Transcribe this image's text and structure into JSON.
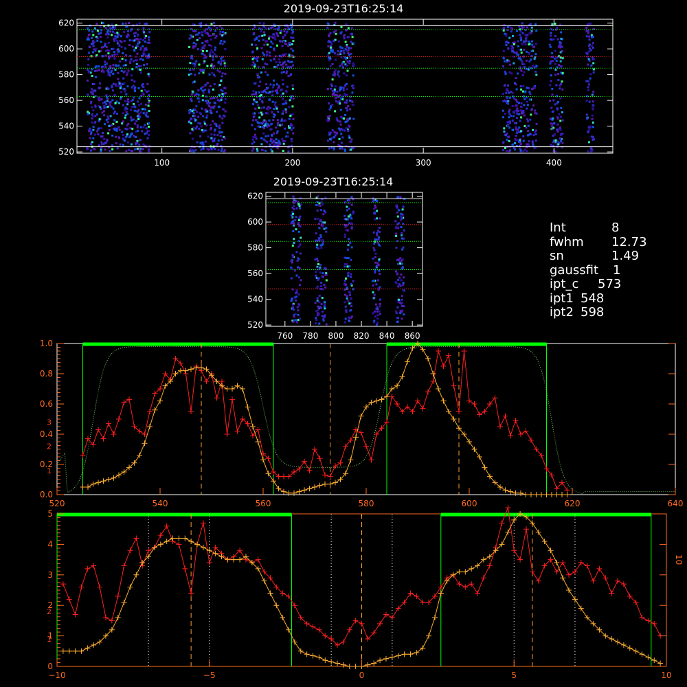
{
  "stats": {
    "int_label": "Int",
    "int_value": "8",
    "fwhm_label": "fwhm",
    "fwhm_value": "12.73",
    "sn_label": "sn",
    "sn_value": "1.49",
    "gaussfit_label": "gaussfit",
    "gaussfit_value": "1",
    "iptc_label": "ipt_c",
    "iptc_value": "573",
    "ipt1_label": "ipt1",
    "ipt1_value": "548",
    "ipt2_label": "ipt2",
    "ipt2_value": "598"
  },
  "colors": {
    "background": "#000000",
    "axes": "#ffffff",
    "red_profile": "#ff2020",
    "orange_profile": "#ffb030",
    "green_window": "#00ff00",
    "orange_axis": "#ff6a20",
    "white_axis": "#ffffff"
  },
  "chart_data": [
    {
      "type": "heatmap",
      "title": "2019-09-23T16:25:14",
      "xlim": [
        35,
        445
      ],
      "ylim": [
        519,
        623
      ],
      "xticks": [
        "100",
        "200",
        "300",
        "400"
      ],
      "yticks": [
        "520",
        "540",
        "560",
        "580",
        "600",
        "620"
      ],
      "bright_columns": [
        [
          42,
          90
        ],
        [
          120,
          148
        ],
        [
          168,
          200
        ],
        [
          226,
          246
        ],
        [
          360,
          386
        ],
        [
          396,
          406
        ],
        [
          424,
          430
        ]
      ],
      "guide_lines": [
        {
          "y": 524,
          "color": "#ffffff"
        },
        {
          "y": 618,
          "color": "#ffffff"
        },
        {
          "y": 615,
          "color": "#00ff00"
        },
        {
          "y": 594,
          "color": "#ff2020"
        },
        {
          "y": 585,
          "color": "#00ff00"
        },
        {
          "y": 563,
          "color": "#00ff00"
        }
      ]
    },
    {
      "type": "heatmap",
      "title": "2019-09-23T16:25:14",
      "xlim": [
        745,
        868
      ],
      "ylim": [
        519,
        623
      ],
      "xticks": [
        "760",
        "780",
        "800",
        "820",
        "840",
        "860"
      ],
      "yticks": [
        "520",
        "540",
        "560",
        "580",
        "600",
        "620"
      ],
      "bright_columns": [
        [
          764,
          772
        ],
        [
          783,
          792
        ],
        [
          806,
          813
        ],
        [
          828,
          834
        ],
        [
          846,
          853
        ]
      ],
      "guide_lines": [
        {
          "y": 618,
          "color": "#ffffff"
        },
        {
          "y": 615,
          "color": "#00ff00"
        },
        {
          "y": 585,
          "color": "#00ff00"
        },
        {
          "y": 563,
          "color": "#00ff00"
        },
        {
          "y": 548,
          "color": "#ff2020"
        },
        {
          "y": 598,
          "color": "#ff2020"
        }
      ]
    },
    {
      "type": "line",
      "xlim": [
        520,
        640
      ],
      "xticks": [
        "520",
        "540",
        "560",
        "580",
        "600",
        "620",
        "640"
      ],
      "ylim": [
        0,
        1.0
      ],
      "yticks": [
        "0.0",
        "0.2",
        "0.4",
        "0.6",
        "0.8",
        "1.0"
      ],
      "right_red_ticks": [
        "1",
        "2",
        "3"
      ],
      "series": [
        {
          "color": "#ff2020",
          "x": [
            525,
            526,
            527,
            528,
            529,
            530,
            531,
            532,
            533,
            534,
            535,
            536,
            537,
            538,
            539,
            540,
            541,
            542,
            543,
            544,
            545,
            546,
            547,
            548,
            549,
            550,
            551,
            552,
            553,
            554,
            555,
            556,
            557,
            558,
            559,
            560,
            561,
            562,
            563,
            564,
            565,
            566,
            567,
            568,
            569,
            570,
            571,
            572,
            573,
            574,
            575,
            576,
            577,
            578,
            579,
            580,
            581,
            582,
            583,
            584,
            585,
            586,
            587,
            588,
            589,
            590,
            591,
            592,
            593,
            594,
            595,
            596,
            597,
            598,
            599,
            600,
            601,
            602,
            603,
            604,
            605,
            606,
            607,
            608,
            609,
            610,
            611,
            612,
            613,
            614,
            615,
            616,
            617,
            618,
            619
          ],
          "y": [
            0.26,
            0.37,
            0.33,
            0.43,
            0.37,
            0.47,
            0.4,
            0.5,
            0.61,
            0.63,
            0.45,
            0.42,
            0.4,
            0.55,
            0.67,
            0.7,
            0.8,
            0.76,
            0.9,
            0.87,
            0.8,
            0.55,
            0.85,
            0.82,
            0.75,
            0.8,
            0.64,
            0.75,
            0.4,
            0.63,
            0.42,
            0.5,
            0.47,
            0.39,
            0.43,
            0.27,
            0.24,
            0.15,
            0.12,
            0.12,
            0.12,
            0.15,
            0.17,
            0.22,
            0.16,
            0.3,
            0.24,
            0.13,
            0.12,
            0.19,
            0.21,
            0.32,
            0.36,
            0.43,
            0.41,
            0.32,
            0.23,
            0.4,
            0.44,
            0.48,
            0.65,
            0.6,
            0.55,
            0.58,
            0.55,
            0.62,
            0.57,
            0.68,
            0.75,
            0.95,
            0.85,
            0.92,
            0.72,
            0.55,
            0.95,
            0.62,
            0.6,
            0.53,
            0.55,
            0.6,
            0.64,
            0.45,
            0.52,
            0.39,
            0.49,
            0.4,
            0.42,
            0.36,
            0.3,
            0.26,
            0.17,
            0.13,
            0.04,
            0.08,
            0.03
          ]
        },
        {
          "color": "#ffb030",
          "x": [
            525,
            526,
            527,
            528,
            529,
            530,
            531,
            532,
            533,
            534,
            535,
            536,
            537,
            538,
            539,
            540,
            541,
            542,
            543,
            544,
            545,
            546,
            547,
            548,
            549,
            550,
            551,
            552,
            553,
            554,
            555,
            556,
            557,
            558,
            559,
            560,
            561,
            562,
            563,
            564,
            565,
            566,
            567,
            568,
            569,
            570,
            571,
            572,
            573,
            574,
            575,
            576,
            577,
            578,
            579,
            580,
            581,
            582,
            583,
            584,
            585,
            586,
            587,
            588,
            589,
            590,
            591,
            592,
            593,
            594,
            595,
            596,
            597,
            598,
            599,
            600,
            601,
            602,
            603,
            604,
            605,
            606,
            607,
            608,
            609,
            610,
            611,
            612,
            613,
            614,
            615,
            616,
            617,
            618,
            619
          ],
          "y": [
            0.05,
            0.05,
            0.07,
            0.08,
            0.09,
            0.1,
            0.11,
            0.13,
            0.15,
            0.18,
            0.21,
            0.26,
            0.34,
            0.45,
            0.56,
            0.62,
            0.72,
            0.75,
            0.8,
            0.82,
            0.82,
            0.83,
            0.84,
            0.84,
            0.83,
            0.79,
            0.75,
            0.72,
            0.7,
            0.7,
            0.72,
            0.7,
            0.58,
            0.45,
            0.35,
            0.23,
            0.14,
            0.09,
            0.04,
            0.02,
            0.01,
            0.01,
            0.02,
            0.03,
            0.04,
            0.05,
            0.06,
            0.07,
            0.07,
            0.08,
            0.1,
            0.14,
            0.23,
            0.38,
            0.52,
            0.58,
            0.61,
            0.62,
            0.63,
            0.65,
            0.7,
            0.72,
            0.78,
            0.88,
            0.97,
            1.0,
            0.96,
            0.9,
            0.8,
            0.7,
            0.62,
            0.55,
            0.5,
            0.44,
            0.4,
            0.35,
            0.3,
            0.25,
            0.18,
            0.12,
            0.08,
            0.05,
            0.03,
            0.02,
            0.01,
            0.01,
            0.0,
            0.0,
            0.0,
            0.0,
            0.0,
            0.0,
            0.0,
            0.0,
            0.0
          ]
        }
      ],
      "green_windows": [
        [
          525,
          562
        ],
        [
          584,
          615
        ]
      ],
      "vertical_markers": [
        548,
        573,
        598
      ]
    },
    {
      "type": "line",
      "xlim": [
        -10,
        10
      ],
      "xticks": [
        "−10",
        "−5",
        "0",
        "5",
        "10"
      ],
      "ylim": [
        0,
        5
      ],
      "yticks": [
        "0",
        "1",
        "2",
        "3",
        "4",
        "5"
      ],
      "right_red_ticks": [
        "1",
        "2"
      ],
      "right_orange_ticks": [
        "10"
      ],
      "series": [
        {
          "color": "#ff2020",
          "x": [
            -9.8,
            -9.6,
            -9.4,
            -9.2,
            -9.0,
            -8.8,
            -8.6,
            -8.4,
            -8.2,
            -8.0,
            -7.8,
            -7.6,
            -7.4,
            -7.2,
            -7.0,
            -6.8,
            -6.6,
            -6.4,
            -6.2,
            -6.0,
            -5.8,
            -5.6,
            -5.4,
            -5.2,
            -5.0,
            -4.8,
            -4.6,
            -4.4,
            -4.2,
            -4.0,
            -3.8,
            -3.6,
            -3.4,
            -3.2,
            -3.0,
            -2.8,
            -2.6,
            -2.4,
            -2.2,
            -2.0,
            -1.8,
            -1.6,
            -1.4,
            -1.2,
            -1.0,
            -0.8,
            -0.6,
            -0.4,
            -0.2,
            0.0,
            0.2,
            0.4,
            0.6,
            0.8,
            1.0,
            1.2,
            1.4,
            1.6,
            1.8,
            2.0,
            2.2,
            2.4,
            2.6,
            2.8,
            3.0,
            3.2,
            3.4,
            3.6,
            3.8,
            4.0,
            4.2,
            4.4,
            4.6,
            4.8,
            5.0,
            5.2,
            5.4,
            5.6,
            5.8,
            6.0,
            6.2,
            6.4,
            6.6,
            6.8,
            7.0,
            7.2,
            7.4,
            7.6,
            7.8,
            8.0,
            8.2,
            8.4,
            8.6,
            8.8,
            9.0,
            9.2,
            9.4,
            9.6,
            9.8
          ],
          "y": [
            2.7,
            2.2,
            1.7,
            2.6,
            3.2,
            3.3,
            2.6,
            1.6,
            1.5,
            2.3,
            3.3,
            3.8,
            4.2,
            3.3,
            3.8,
            3.9,
            4.3,
            4.6,
            4.1,
            4.0,
            3.2,
            2.4,
            4.0,
            4.7,
            3.4,
            3.9,
            3.7,
            3.5,
            3.6,
            3.8,
            3.5,
            3.4,
            3.5,
            3.1,
            2.9,
            2.6,
            2.4,
            2.3,
            2.0,
            1.6,
            1.4,
            1.3,
            1.2,
            1.0,
            0.9,
            0.7,
            0.8,
            1.2,
            1.5,
            1.4,
            0.9,
            1.1,
            1.4,
            1.7,
            1.6,
            1.9,
            2.1,
            2.4,
            2.3,
            2.1,
            2.1,
            2.3,
            2.6,
            2.9,
            3.0,
            2.7,
            2.6,
            2.7,
            2.4,
            2.9,
            3.3,
            3.9,
            4.7,
            5.2,
            3.8,
            3.5,
            4.5,
            3.1,
            2.8,
            3.3,
            3.5,
            3.1,
            3.4,
            3.0,
            3.1,
            3.4,
            3.3,
            2.8,
            3.2,
            2.9,
            2.4,
            2.8,
            2.7,
            2.3,
            2.1,
            1.6,
            1.5,
            1.4,
            1.0
          ]
        },
        {
          "color": "#ffb030",
          "x": [
            -9.8,
            -9.6,
            -9.4,
            -9.2,
            -9.0,
            -8.8,
            -8.6,
            -8.4,
            -8.2,
            -8.0,
            -7.8,
            -7.6,
            -7.4,
            -7.2,
            -7.0,
            -6.8,
            -6.6,
            -6.4,
            -6.2,
            -6.0,
            -5.8,
            -5.6,
            -5.4,
            -5.2,
            -5.0,
            -4.8,
            -4.6,
            -4.4,
            -4.2,
            -4.0,
            -3.8,
            -3.6,
            -3.4,
            -3.2,
            -3.0,
            -2.8,
            -2.6,
            -2.4,
            -2.2,
            -2.0,
            -1.8,
            -1.6,
            -1.4,
            -1.2,
            -1.0,
            -0.8,
            -0.6,
            -0.4,
            -0.2,
            0.0,
            0.2,
            0.4,
            0.6,
            0.8,
            1.0,
            1.2,
            1.4,
            1.6,
            1.8,
            2.0,
            2.2,
            2.4,
            2.6,
            2.8,
            3.0,
            3.2,
            3.4,
            3.6,
            3.8,
            4.0,
            4.2,
            4.4,
            4.6,
            4.8,
            5.0,
            5.2,
            5.4,
            5.6,
            5.8,
            6.0,
            6.2,
            6.4,
            6.6,
            6.8,
            7.0,
            7.2,
            7.4,
            7.6,
            7.8,
            8.0,
            8.2,
            8.4,
            8.6,
            8.8,
            9.0,
            9.2,
            9.4,
            9.6,
            9.8
          ],
          "y": [
            0.5,
            0.5,
            0.5,
            0.5,
            0.6,
            0.7,
            0.8,
            1.0,
            1.2,
            1.6,
            2.1,
            2.6,
            3.0,
            3.4,
            3.6,
            3.9,
            4.0,
            4.1,
            4.2,
            4.2,
            4.2,
            4.1,
            4.0,
            3.9,
            3.8,
            3.7,
            3.6,
            3.5,
            3.5,
            3.5,
            3.6,
            3.4,
            3.2,
            2.8,
            2.4,
            2.0,
            1.6,
            1.2,
            0.8,
            0.5,
            0.4,
            0.35,
            0.3,
            0.2,
            0.15,
            0.1,
            0.05,
            0.0,
            0.0,
            0.0,
            0.05,
            0.1,
            0.2,
            0.25,
            0.3,
            0.35,
            0.4,
            0.4,
            0.45,
            0.6,
            1.0,
            1.6,
            2.4,
            2.8,
            3.0,
            3.1,
            3.1,
            3.2,
            3.3,
            3.5,
            3.6,
            3.8,
            4.0,
            4.4,
            4.8,
            5.0,
            4.9,
            4.7,
            4.4,
            4.1,
            3.8,
            3.4,
            2.9,
            2.5,
            2.2,
            1.9,
            1.6,
            1.4,
            1.2,
            1.0,
            0.9,
            0.8,
            0.7,
            0.6,
            0.5,
            0.4,
            0.3,
            0.2,
            0.1
          ]
        }
      ],
      "green_windows": [
        [
          -10,
          -2.3
        ],
        [
          2.6,
          9.5
        ]
      ],
      "dotted_markers": [
        -7.0,
        -5.0,
        -1.0,
        1.0,
        5.0,
        7.0
      ],
      "vertical_markers": [
        -5.6,
        0.0,
        5.6
      ]
    }
  ]
}
